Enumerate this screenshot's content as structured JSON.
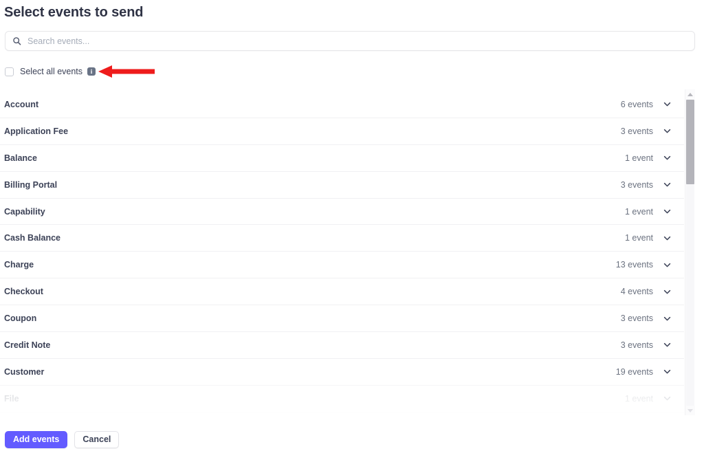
{
  "page": {
    "title": "Select events to send"
  },
  "search": {
    "placeholder": "Search events...",
    "value": "",
    "icon": "search-icon"
  },
  "select_all": {
    "label": "Select all events",
    "checked": false,
    "info_icon_glyph": "i"
  },
  "annotation": {
    "type": "arrow",
    "direction": "left",
    "color": "#ee1c1c"
  },
  "list": {
    "rows": [
      {
        "name": "Account",
        "count": "6 events",
        "chevron": "chevron-down-icon",
        "dimmed": false
      },
      {
        "name": "Application Fee",
        "count": "3 events",
        "chevron": "chevron-down-icon",
        "dimmed": false
      },
      {
        "name": "Balance",
        "count": "1 event",
        "chevron": "chevron-down-icon",
        "dimmed": false
      },
      {
        "name": "Billing Portal",
        "count": "3 events",
        "chevron": "chevron-down-icon",
        "dimmed": false
      },
      {
        "name": "Capability",
        "count": "1 event",
        "chevron": "chevron-down-icon",
        "dimmed": false
      },
      {
        "name": "Cash Balance",
        "count": "1 event",
        "chevron": "chevron-down-icon",
        "dimmed": false
      },
      {
        "name": "Charge",
        "count": "13 events",
        "chevron": "chevron-down-icon",
        "dimmed": false
      },
      {
        "name": "Checkout",
        "count": "4 events",
        "chevron": "chevron-down-icon",
        "dimmed": false
      },
      {
        "name": "Coupon",
        "count": "3 events",
        "chevron": "chevron-down-icon",
        "dimmed": false
      },
      {
        "name": "Credit Note",
        "count": "3 events",
        "chevron": "chevron-down-icon",
        "dimmed": false
      },
      {
        "name": "Customer",
        "count": "19 events",
        "chevron": "chevron-down-icon",
        "dimmed": false
      },
      {
        "name": "File",
        "count": "1 event",
        "chevron": "chevron-down-icon",
        "dimmed": true
      }
    ]
  },
  "scrollbar": {
    "up_arrow": "scroll-up-arrow-icon",
    "down_arrow": "scroll-down-arrow-icon"
  },
  "footer": {
    "primary_label": "Add events",
    "secondary_label": "Cancel"
  },
  "colors": {
    "brand": "#635bff",
    "text": "#3c4257",
    "muted": "#6b7280",
    "annotation": "#ee1c1c"
  }
}
